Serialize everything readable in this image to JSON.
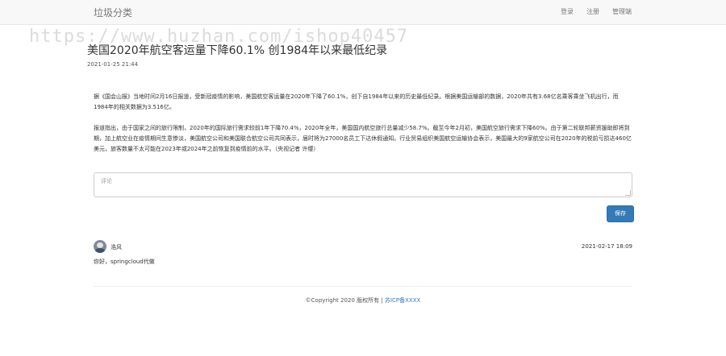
{
  "navbar": {
    "brand": "垃圾分类",
    "links": [
      "登录",
      "注册",
      "管理端"
    ]
  },
  "watermark": "https://www.huzhan.com/ishop40457",
  "article": {
    "title": "美国2020年航空客运量下降60.1% 创1984年以来最低纪录",
    "date": "2021-01-25 21:44",
    "paragraphs": [
      "据《国会山报》当地时间2月16日报道，受新冠疫情的影响，美国航空客运量在2020年下降了60.1%，创下自1984年以来的历史最低纪录。根据美国运输部的数据，2020年共有3.68亿名乘客乘坐飞机出行，而1984年的相关数据为3.516亿。",
      "报道指出，由于国家之间的旅行限制，2020年的国际旅行需求较前1年下降70.4%，2020年全年，美国国内航空旅行总量减少58.7%。截至今年2月初，美国航空旅行需求下降60%。由于第二轮联邦薪资援助即将到期，加上航空业在疫情期间生意惨淡，美国航空公司和美国联合航空公司共同表示，届时将为27000名员工下达休假通知。行业贸易组织美国航空运输协会表示，美国最大的9家航空公司在2020年的税前亏损达460亿美元，旅客数量不太可能在2023年或2024年之前恢复到疫情前的水平。（央视记者 许缨）"
    ]
  },
  "comment_form": {
    "placeholder": "评论",
    "save_label": "保存"
  },
  "comments": [
    {
      "author": "浩风",
      "time": "2021-02-17 18:09",
      "text": "你好，springcloud代做"
    }
  ],
  "footer": {
    "copyright": "©Copyright 2020 版权所有 | ",
    "icp": "苏ICP备XXXX"
  }
}
